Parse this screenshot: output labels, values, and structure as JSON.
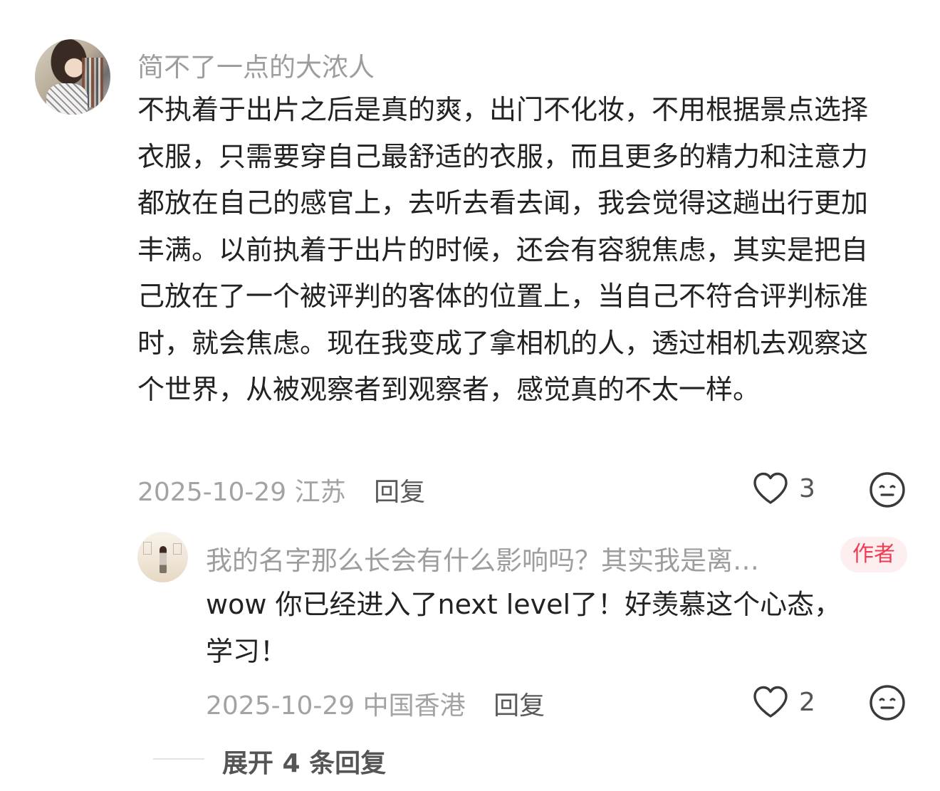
{
  "comment": {
    "username": "简不了一点的大浓人",
    "text": "不执着于出片之后是真的爽，出门不化妆，不用根据景点选择衣服，只需要穿自己最舒适的衣服，而且更多的精力和注意力都放在自己的感官上，去听去看去闻，我会觉得这趟出行更加丰满。以前执着于出片的时候，还会有容貌焦虑，其实是把自己放在了一个被评判的客体的位置上，当自己不符合评判标准时，就会焦虑。现在我变成了拿相机的人，透过相机去观察这个世界，从被观察者到观察者，感觉真的不太一样。",
    "date": "2025-10-29",
    "location": "江苏",
    "reply_label": "回复",
    "likes": "3",
    "avatar_icon": "user-photo-avatar",
    "like_icon": "heart-outline-icon",
    "emoji_icon": "neutral-face-icon"
  },
  "reply": {
    "username": "我的名字那么长会有什么影响吗？其实我是离…",
    "badge": "作者",
    "text_line1": "wow 你已经进入了next level了！好羡慕这个心态，",
    "text_line2": "学习！",
    "date": "2025-10-29",
    "location": "中国香港",
    "reply_label": "回复",
    "likes": "2",
    "avatar_icon": "user-photo-avatar",
    "like_icon": "heart-outline-icon",
    "emoji_icon": "neutral-face-icon"
  },
  "expand": {
    "label": "展开 4 条回复"
  },
  "colors": {
    "text_primary": "#222222",
    "text_secondary": "#9d9d9d",
    "badge_text": "#ee3d52",
    "badge_bg": "#fdeef0",
    "icon": "#3a3a3a"
  }
}
